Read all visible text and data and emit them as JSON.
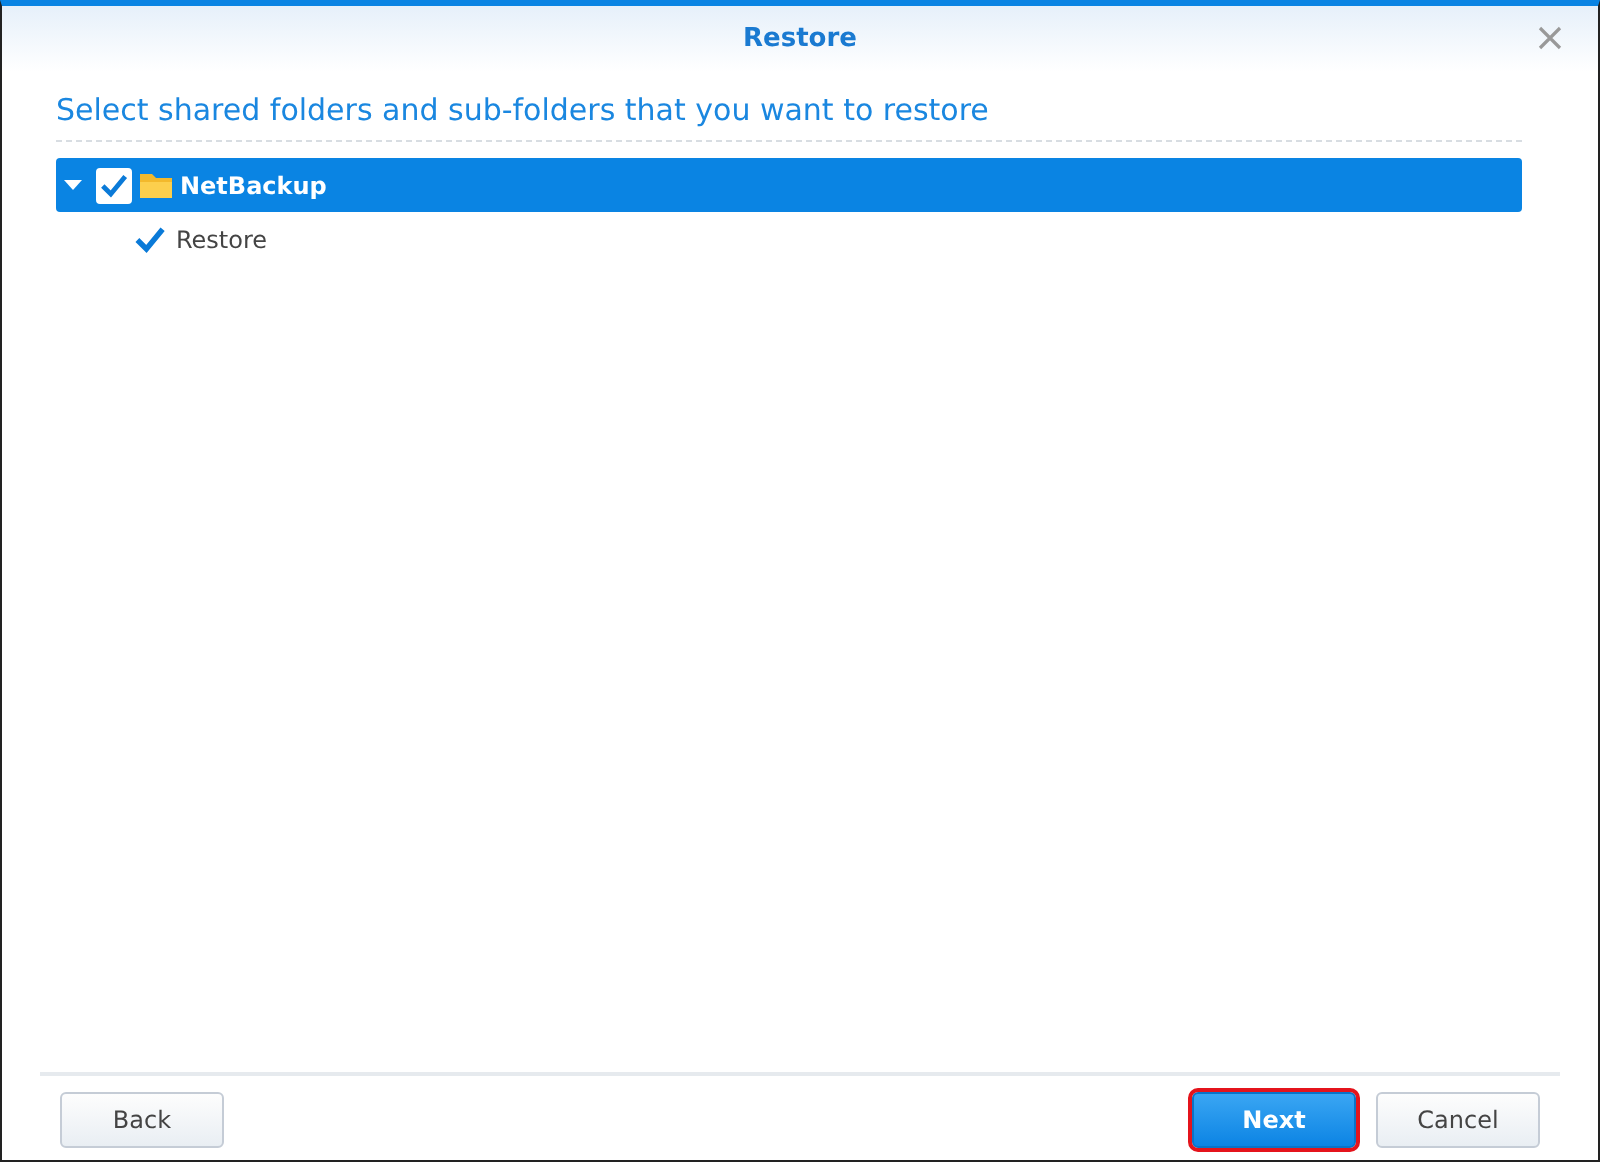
{
  "window": {
    "title": "Restore"
  },
  "heading": "Select shared folders and sub-folders that you want to restore",
  "tree": [
    {
      "label": "NetBackup",
      "checked": true,
      "expanded": true,
      "selected": true,
      "kind": "folder",
      "children": [
        {
          "label": "Restore",
          "checked": true,
          "selected": false
        }
      ]
    }
  ],
  "buttons_left": [
    {
      "label": "Back",
      "primary": false,
      "highlighted": false
    }
  ],
  "buttons_right": [
    {
      "label": "Next",
      "primary": true,
      "highlighted": true
    },
    {
      "label": "Cancel",
      "primary": false,
      "highlighted": false
    }
  ]
}
